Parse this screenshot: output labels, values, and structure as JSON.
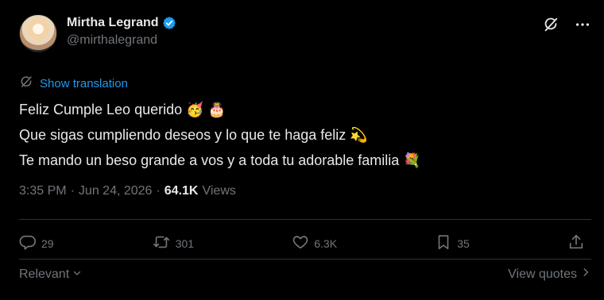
{
  "author": {
    "display_name": "Mirtha Legrand",
    "handle": "@mirthalegrand",
    "verified_color": "#1d9bf0"
  },
  "icons": {
    "verified": "verified-badge-icon",
    "grok": "grok-icon",
    "more": "more-options-icon",
    "translate": "globe-icon",
    "reply": "reply-icon",
    "retweet": "retweet-icon",
    "like": "heart-icon",
    "bookmark": "bookmark-icon",
    "share": "share-icon"
  },
  "translate_label": "Show translation",
  "tweet": {
    "line1": "Feliz Cumple Leo querido",
    "line1_emoji": "🥳 🎂",
    "line2": "Que sigas cumpliendo deseos y lo que te haga feliz",
    "line2_emoji": "💫",
    "line3": "Te mando un beso grande a vos y a toda tu adorable familia",
    "line3_emoji": "💐"
  },
  "meta": {
    "time": "3:35 PM",
    "sep1": "·",
    "date": "Jun 24, 2026",
    "sep2": "·",
    "views_count": "64.1K",
    "views_label": "Views"
  },
  "stats": {
    "replies": "29",
    "retweets": "301",
    "likes": "6.3K",
    "bookmarks": "35"
  },
  "bottom": {
    "sort_label": "Relevant",
    "quotes_label": "View quotes"
  },
  "colors": {
    "background": "#000000",
    "text": "#e7e9ea",
    "muted": "#71767b",
    "accent": "#1d9bf0",
    "divider": "#2f3336"
  }
}
